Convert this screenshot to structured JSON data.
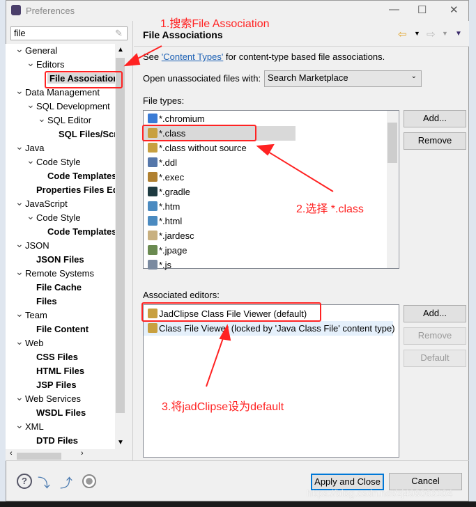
{
  "window": {
    "title": "Preferences",
    "minimize": "—",
    "maximize": "☐",
    "close": "✕"
  },
  "search": {
    "value": "file"
  },
  "tree": [
    {
      "label": "General",
      "level": 0,
      "expanded": true,
      "bold": false
    },
    {
      "label": "Editors",
      "level": 1,
      "expanded": true,
      "bold": false
    },
    {
      "label": "File Association",
      "level": 2,
      "bold": true,
      "selected": true
    },
    {
      "label": "Data Management",
      "level": 0,
      "expanded": true
    },
    {
      "label": "SQL Development",
      "level": 1,
      "expanded": true
    },
    {
      "label": "SQL Editor",
      "level": 2,
      "expanded": true
    },
    {
      "label": "SQL Files/Scr",
      "level": 3,
      "bold": true
    },
    {
      "label": "Java",
      "level": 0,
      "expanded": true
    },
    {
      "label": "Code Style",
      "level": 1,
      "expanded": true
    },
    {
      "label": "Code Templates",
      "level": 2,
      "bold": true
    },
    {
      "label": "Properties Files Ed",
      "level": 1,
      "bold": true
    },
    {
      "label": "JavaScript",
      "level": 0,
      "expanded": true
    },
    {
      "label": "Code Style",
      "level": 1,
      "expanded": true
    },
    {
      "label": "Code Templates",
      "level": 2,
      "bold": true
    },
    {
      "label": "JSON",
      "level": 0,
      "expanded": true
    },
    {
      "label": "JSON Files",
      "level": 1,
      "bold": true
    },
    {
      "label": "Remote Systems",
      "level": 0,
      "expanded": true
    },
    {
      "label": "File Cache",
      "level": 1,
      "bold": true
    },
    {
      "label": "Files",
      "level": 1,
      "bold": true
    },
    {
      "label": "Team",
      "level": 0,
      "expanded": true
    },
    {
      "label": "File Content",
      "level": 1,
      "bold": true
    },
    {
      "label": "Web",
      "level": 0,
      "expanded": true
    },
    {
      "label": "CSS Files",
      "level": 1,
      "bold": true
    },
    {
      "label": "HTML Files",
      "level": 1,
      "bold": true
    },
    {
      "label": "JSP Files",
      "level": 1,
      "bold": true
    },
    {
      "label": "Web Services",
      "level": 0,
      "expanded": true
    },
    {
      "label": "WSDL Files",
      "level": 1,
      "bold": true
    },
    {
      "label": "XML",
      "level": 0,
      "expanded": true
    },
    {
      "label": "DTD Files",
      "level": 1,
      "bold": true
    }
  ],
  "page": {
    "title": "File Associations",
    "see_prefix": "See ",
    "see_link": "'Content Types'",
    "see_suffix": " for content-type based file associations.",
    "open_label": "Open unassociated files with:",
    "open_value": "Search Marketplace",
    "file_types_label": "File types:",
    "assoc_label": "Associated editors:"
  },
  "file_types": [
    {
      "label": "*.chromium",
      "icon": "chromium-icon",
      "color": "#3a7bd5"
    },
    {
      "label": "*.class",
      "icon": "class-file-icon",
      "color": "#c8a040",
      "selected": true
    },
    {
      "label": "*.class without source",
      "icon": "class-file-icon",
      "color": "#c8a040"
    },
    {
      "label": "*.ddl",
      "icon": "ddl-icon",
      "color": "#5577aa"
    },
    {
      "label": "*.exec",
      "icon": "gear-icon",
      "color": "#b08030"
    },
    {
      "label": "*.gradle",
      "icon": "gradle-icon",
      "color": "#1e3a40"
    },
    {
      "label": "*.htm",
      "icon": "globe-icon",
      "color": "#4a8ac0"
    },
    {
      "label": "*.html",
      "icon": "globe-icon",
      "color": "#4a8ac0"
    },
    {
      "label": "*.jardesc",
      "icon": "jar-icon",
      "color": "#c8b080"
    },
    {
      "label": "*.jpage",
      "icon": "jpage-icon",
      "color": "#6a8a50"
    },
    {
      "label": "*.js",
      "icon": "js-file-icon",
      "color": "#7a8aa0"
    }
  ],
  "editors": [
    {
      "label": "JadClipse Class File Viewer (default)",
      "icon": "class-file-icon"
    },
    {
      "label": "Class File Viewer (locked by 'Java Class File' content type)",
      "icon": "class-file-icon",
      "selected": true
    }
  ],
  "buttons": {
    "add": "Add...",
    "remove": "Remove",
    "add2": "Add...",
    "remove2": "Remove",
    "default": "Default",
    "apply_close": "Apply and Close",
    "cancel": "Cancel"
  },
  "annotations": {
    "step1": "1.搜索File Association",
    "step2": "2.选择 *.class",
    "step3": "3.将jadClipse设为default",
    "color": "#ff2222"
  },
  "watermark": "https://blog.csdn.net/zj499063104"
}
